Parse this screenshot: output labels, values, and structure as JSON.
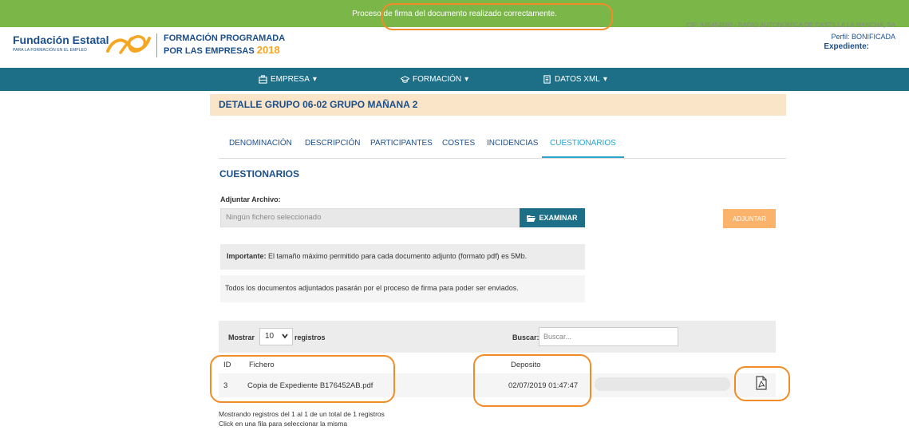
{
  "alert": {
    "message": "Proceso de firma del documento realizado correctamente."
  },
  "header": {
    "org_name": "Fundación Estatal",
    "org_sub": "PARA LA FORMACIÓN EN EL EMPLEO",
    "program_line1": "FORMACIÓN PROGRAMADA",
    "program_line2": "POR LAS EMPRESAS",
    "program_year": "2018",
    "cif": "CIF: A45454560 - RADIO AUTONOMICA DE CASTILLA LA MANCHA, SA",
    "perfil": "Perfil: BONIFICADA",
    "expediente": "Expediente:"
  },
  "nav": {
    "items": [
      {
        "label": "EMPRESA",
        "icon": "building-icon"
      },
      {
        "label": "FORMACIÓN",
        "icon": "graduation-cap-icon"
      },
      {
        "label": "DATOS XML",
        "icon": "document-icon"
      }
    ]
  },
  "group": {
    "title": "DETALLE GRUPO 06-02 GRUPO MAÑANA 2"
  },
  "tabs": [
    {
      "label": "DENOMINACIÓN"
    },
    {
      "label": "DESCRIPCIÓN"
    },
    {
      "label": "PARTICIPANTES"
    },
    {
      "label": "COSTES"
    },
    {
      "label": "INCIDENCIAS"
    },
    {
      "label": "CUESTIONARIOS",
      "active": true
    }
  ],
  "cuestionarios": {
    "title": "CUESTIONARIOS",
    "attach_label": "Adjuntar Archivo:",
    "file_placeholder": "Ningún fichero seleccionado",
    "browse_label": "EXAMINAR",
    "attach_button": "ADJUNTAR",
    "note_bold": "Importante:",
    "note_text": " El tamaño máximo permitido para cada documento adjunto (formato pdf) es 5Mb.",
    "info_text": "Todos los documentos adjuntados pasarán por el proceso de firma para poder ser enviados."
  },
  "table": {
    "show_label": "Mostrar",
    "page_size": "10",
    "records_label": "registros",
    "search_label": "Buscar:",
    "search_placeholder": "Buscar...",
    "columns": {
      "id": "ID",
      "file": "Fichero",
      "deposit": "Deposito"
    },
    "rows": [
      {
        "id": "3",
        "file": "Copia de Expediente B176452AB.pdf",
        "deposit": "02/07/2019 01:47:47"
      }
    ],
    "footer": "Mostrando registros del 1 al 1 de un total de 1 registros   Click en una fila para seleccionar la misma"
  },
  "colors": {
    "alert_bg": "#7ab648",
    "nav_bg": "#1c6f87",
    "primary_text": "#1b4f8c",
    "accent": "#f5a623",
    "annotation": "#f28c28",
    "group_bg": "#fbe5c8",
    "active_tab": "#2aa3cc"
  }
}
